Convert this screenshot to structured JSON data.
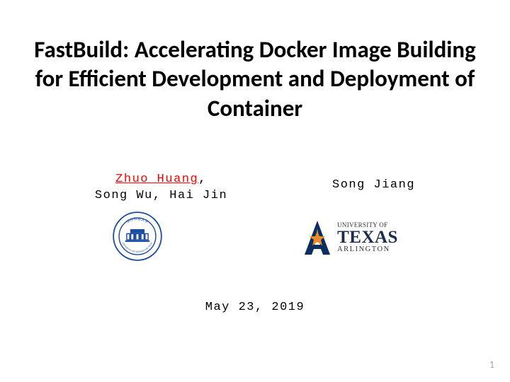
{
  "title": "FastBuild: Accelerating Docker Image Building for Efficient Development and Deployment of Container",
  "authors": {
    "left": {
      "highlighted": "Zhuo Huang",
      "comma": ",",
      "line2": "Song Wu, Hai Jin",
      "logo_label": "HUST Logo"
    },
    "right": {
      "name": "Song Jiang",
      "logo": {
        "univ_of": "UNIVERSITY OF",
        "texas": "TEXAS",
        "arlington": "ARLINGTON"
      }
    }
  },
  "date": "May 23, 2019",
  "page_number": "1"
}
